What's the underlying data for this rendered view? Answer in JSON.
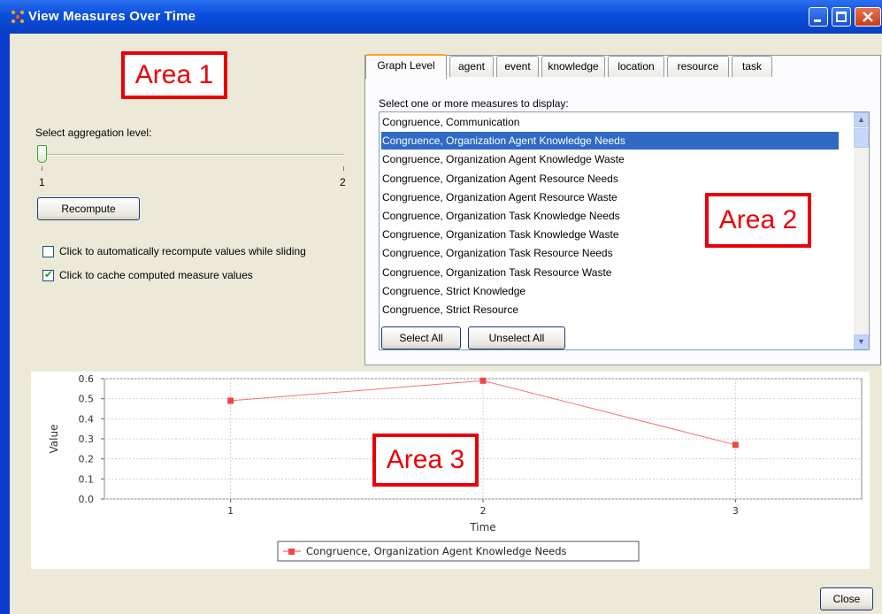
{
  "window": {
    "title": "View Measures Over Time"
  },
  "area1": {
    "marker": "Area 1",
    "aggregation_label": "Select aggregation level:",
    "slider_min": "1",
    "slider_max": "2",
    "slider_value": 1,
    "recompute_label": "Recompute",
    "auto_recompute_label": "Click to automatically recompute values while sliding",
    "auto_recompute_checked": false,
    "cache_label": "Click to cache computed measure values",
    "cache_checked": true
  },
  "area2": {
    "marker": "Area 2",
    "tabs": [
      {
        "label": "Graph Level",
        "active": true
      },
      {
        "label": "agent",
        "active": false
      },
      {
        "label": "event",
        "active": false
      },
      {
        "label": "knowledge",
        "active": false
      },
      {
        "label": "location",
        "active": false
      },
      {
        "label": "resource",
        "active": false
      },
      {
        "label": "task",
        "active": false
      }
    ],
    "prompt": "Select one or more measures to display:",
    "measures": [
      {
        "label": "Congruence, Communication",
        "selected": false
      },
      {
        "label": "Congruence, Organization Agent Knowledge Needs",
        "selected": true
      },
      {
        "label": "Congruence, Organization Agent Knowledge Waste",
        "selected": false
      },
      {
        "label": "Congruence, Organization Agent Resource Needs",
        "selected": false
      },
      {
        "label": "Congruence, Organization Agent Resource Waste",
        "selected": false
      },
      {
        "label": "Congruence, Organization Task Knowledge Needs",
        "selected": false
      },
      {
        "label": "Congruence, Organization Task Knowledge Waste",
        "selected": false
      },
      {
        "label": "Congruence, Organization Task Resource Needs",
        "selected": false
      },
      {
        "label": "Congruence, Organization Task Resource Waste",
        "selected": false
      },
      {
        "label": "Congruence, Strict Knowledge",
        "selected": false
      },
      {
        "label": "Congruence, Strict Resource",
        "selected": false
      }
    ],
    "select_all_label": "Select All",
    "unselect_all_label": "Unselect All"
  },
  "area3": {
    "marker": "Area 3"
  },
  "close_label": "Close",
  "colors": {
    "title_bar": "#0a4ddc",
    "marker_red": "#e8000a",
    "series": "#f04646",
    "selection": "#316ac5"
  },
  "chart_data": {
    "type": "line",
    "xlabel": "Time",
    "ylabel": "Value",
    "categories": [
      "1",
      "2",
      "3"
    ],
    "series": [
      {
        "name": "Congruence, Organization Agent Knowledge Needs",
        "values": [
          0.49,
          0.59,
          0.27
        ]
      }
    ],
    "ylim": [
      0,
      0.6
    ],
    "yticks": [
      "0.0",
      "0.1",
      "0.2",
      "0.3",
      "0.4",
      "0.5",
      "0.6"
    ],
    "grid": true,
    "legend": "bottom"
  }
}
